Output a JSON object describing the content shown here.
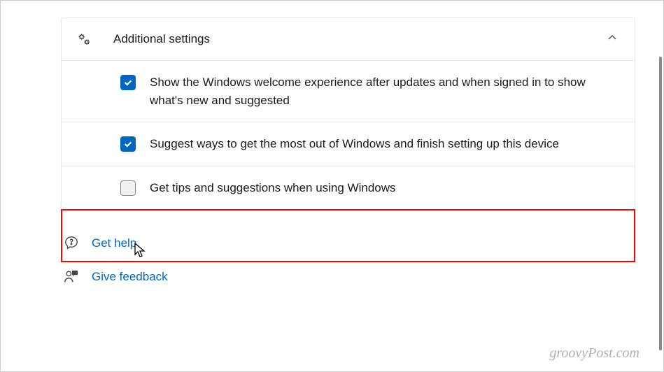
{
  "section": {
    "title": "Additional settings"
  },
  "options": [
    {
      "checked": true,
      "label": "Show the Windows welcome experience after updates and when signed in to show what's new and suggested"
    },
    {
      "checked": true,
      "label": "Suggest ways to get the most out of Windows and finish setting up this device"
    },
    {
      "checked": false,
      "label": "Get tips and suggestions when using Windows"
    }
  ],
  "links": {
    "help": "Get help",
    "feedback": "Give feedback"
  },
  "watermark": "groovyPost.com"
}
